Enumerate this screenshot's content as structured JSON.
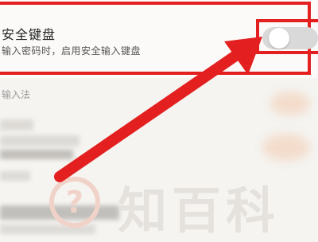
{
  "setting": {
    "title": "安全键盘",
    "subtitle": "输入密码时，启用安全输入键盘",
    "toggle_on": false
  },
  "section": {
    "label": "输入法"
  },
  "watermark": {
    "icon": "question-mark-icon",
    "text": "知百科",
    "glyph": "?"
  },
  "colors": {
    "highlight": "#e3201f",
    "toggle_off": "#d9d9d9"
  }
}
